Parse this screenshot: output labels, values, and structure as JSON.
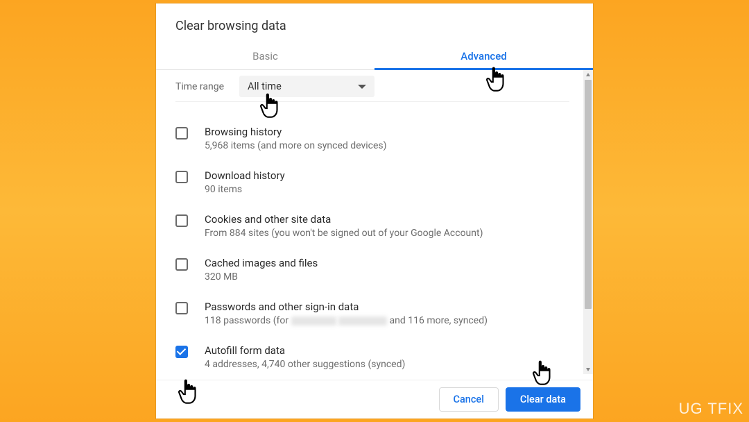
{
  "dialog": {
    "title": "Clear browsing data",
    "tabs": {
      "basic": "Basic",
      "advanced": "Advanced"
    },
    "time": {
      "label": "Time range",
      "selected": "All time"
    },
    "items": [
      {
        "title": "Browsing history",
        "sub": "5,968 items (and more on synced devices)",
        "checked": false
      },
      {
        "title": "Download history",
        "sub": "90 items",
        "checked": false
      },
      {
        "title": "Cookies and other site data",
        "sub": "From 884 sites (you won't be signed out of your Google Account)",
        "checked": false
      },
      {
        "title": "Cached images and files",
        "sub": "320 MB",
        "checked": false
      },
      {
        "title": "Passwords and other sign-in data",
        "sub_prefix": "118 passwords (for ",
        "sub_suffix": " and 116 more, synced)",
        "redacted": true,
        "checked": false
      },
      {
        "title": "Autofill form data",
        "sub": "4 addresses, 4,740 other suggestions (synced)",
        "checked": true
      }
    ],
    "buttons": {
      "cancel": "Cancel",
      "clear": "Clear data"
    }
  },
  "watermark": "UG  TFIX"
}
